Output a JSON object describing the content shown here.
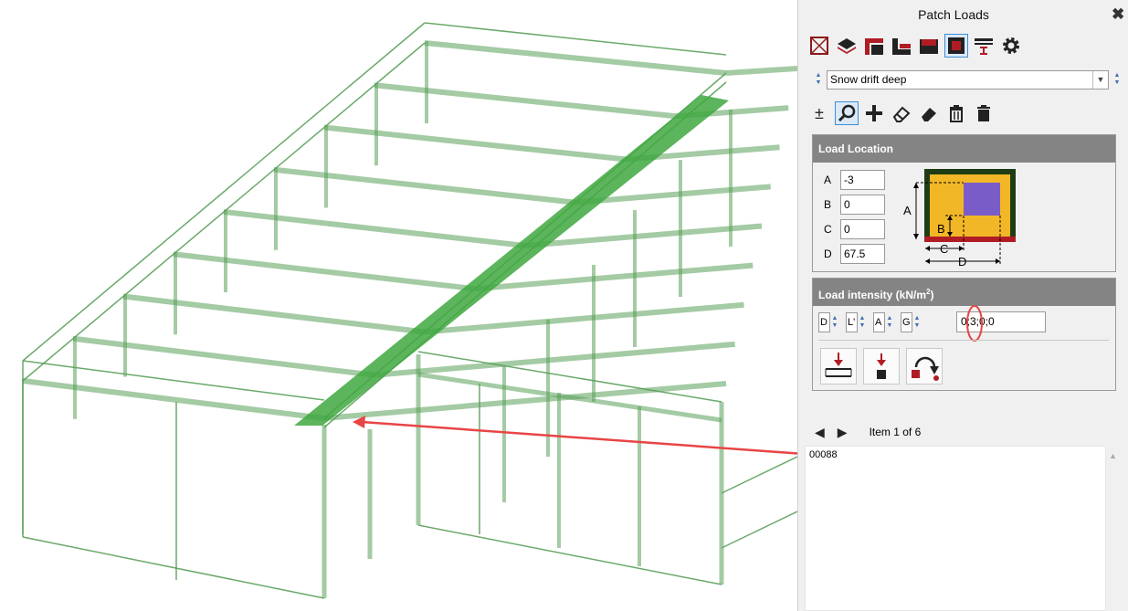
{
  "panel": {
    "title": "Patch Loads",
    "close_icon": "close-icon",
    "toolbar1": [
      {
        "name": "no-load-icon",
        "active": false
      },
      {
        "name": "layers-icon",
        "active": false
      },
      {
        "name": "patch-top-icon",
        "active": false
      },
      {
        "name": "patch-corner-icon",
        "active": false
      },
      {
        "name": "patch-wall-icon",
        "active": false
      },
      {
        "name": "patch-selected-icon",
        "active": true
      },
      {
        "name": "beam-load-icon",
        "active": false
      },
      {
        "name": "gear-icon",
        "active": false
      }
    ],
    "load_case": {
      "selected": "Snow drift deep"
    },
    "toolbar2": [
      {
        "name": "plus-minus-icon",
        "glyph": "±",
        "active": false
      },
      {
        "name": "zoom-icon",
        "active": true
      },
      {
        "name": "add-icon",
        "active": false
      },
      {
        "name": "eraser-icon",
        "active": false
      },
      {
        "name": "eraser-filled-icon",
        "active": false
      },
      {
        "name": "delete-icon",
        "active": false
      },
      {
        "name": "delete-all-icon",
        "active": false
      }
    ],
    "location": {
      "header": "Load Location",
      "fields": [
        {
          "label": "A",
          "value": "-3"
        },
        {
          "label": "B",
          "value": "0"
        },
        {
          "label": "C",
          "value": "0"
        },
        {
          "label": "D",
          "value": "67.5"
        }
      ],
      "diagram_labels": {
        "a": "A",
        "b": "B",
        "c": "C",
        "d": "D"
      },
      "colors": {
        "outer": "#1e3d14",
        "fill": "#f2b726",
        "patch": "#7a5cc8",
        "base": "#b01c24"
      }
    },
    "intensity": {
      "header_prefix": "Load intensity (kN/m",
      "header_sup": "2",
      "header_suffix": ")",
      "selectors": [
        {
          "name": "dead-selector",
          "value": "D"
        },
        {
          "name": "live-selector",
          "value": "L'"
        },
        {
          "name": "a-selector",
          "value": "A"
        },
        {
          "name": "g-selector",
          "value": "G"
        }
      ],
      "value": "0;3;0;0",
      "buttons": [
        {
          "name": "load-distribution-button"
        },
        {
          "name": "point-load-button"
        },
        {
          "name": "moment-button"
        }
      ]
    },
    "navigation": {
      "prev": "◀",
      "next": "▶",
      "count": "Item 1 of 6"
    },
    "list": [
      "00088"
    ]
  },
  "colors": {
    "frame": "#5aa05a",
    "patch": "#3fa83f",
    "accent": "#e84545"
  }
}
